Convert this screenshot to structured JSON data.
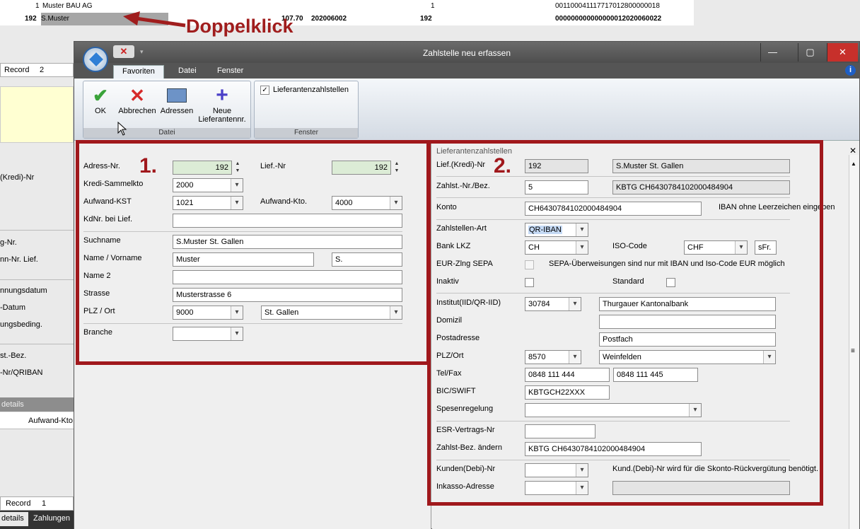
{
  "bg": {
    "row1": {
      "num": "1",
      "name": "Muster BAU AG",
      "col3": "1",
      "code": "001100041117717012800000018"
    },
    "row2": {
      "num": "192",
      "name": "S.Muster",
      "amount": "107.70",
      "date": "202006002",
      "col3": "192",
      "code": "000000000000000012020060022"
    }
  },
  "annotation": {
    "doppelklick": "Doppelklick",
    "section1": "1.",
    "section2": "2."
  },
  "left_panel": {
    "record_label": "Record",
    "record_value": "2",
    "labels": [
      "(Kredi)-Nr",
      "g-Nr.",
      "nn-Nr. Lief.",
      "nnungsdatum",
      "-Datum",
      "ungsbeding.",
      "st.-Bez.",
      "-Nr/QRIBAN"
    ],
    "details_header": "details",
    "aufwand_col": "Aufwand-Kto",
    "record_label2": "Record",
    "record_value2": "1",
    "tabs": [
      "details",
      "Zahlungen"
    ]
  },
  "window": {
    "title": "Zahlstelle neu erfassen",
    "min_icon": "—",
    "max_icon": "▢",
    "close_icon": "✕",
    "menus": [
      "Favoriten",
      "Datei",
      "Fenster"
    ],
    "ribbon": {
      "ok": "OK",
      "abbrechen": "Abbrechen",
      "adressen": "Adressen",
      "neue": "Neue Lieferantennr.",
      "group_datei": "Datei",
      "lieferantenzahlstellen": "Lieferantenzahlstellen",
      "group_fenster": "Fenster"
    }
  },
  "form1": {
    "adress_nr_label": "Adress-Nr.",
    "adress_nr": "192",
    "lief_nr_label": "Lief.-Nr",
    "lief_nr": "192",
    "kredi_label": "Kredi-Sammelkto",
    "kredi": "2000",
    "aufwand_kst_label": "Aufwand-KST",
    "aufwand_kst": "1021",
    "aufwand_kto_label": "Aufwand-Kto.",
    "aufwand_kto": "4000",
    "kdnr_label": "KdNr. bei Lief.",
    "kdnr": "",
    "suchname_label": "Suchname",
    "suchname": "S.Muster St. Gallen",
    "name_label": "Name / Vorname",
    "name": "Muster",
    "vorname": "S.",
    "name2_label": "Name 2",
    "name2": "",
    "strasse_label": "Strasse",
    "strasse": "Musterstrasse 6",
    "plz_label": "PLZ / Ort",
    "plz": "9000",
    "ort": "St. Gallen",
    "branche_label": "Branche",
    "branche": ""
  },
  "form2": {
    "section_title": "Lieferantenzahlstellen",
    "kredi_label": "Lief.(Kredi)-Nr",
    "kredi": "192",
    "kredi_name": "S.Muster St. Gallen",
    "zahlst_label": "Zahlst.-Nr./Bez.",
    "zahlst": "5",
    "zahlst_bez": "KBTG CH6430784102000484904",
    "konto_label": "Konto",
    "konto": "CH6430784102000484904",
    "konto_hint": "IBAN ohne Leerzeichen eingeben",
    "art_label": "Zahlstellen-Art",
    "art": "QR-IBAN",
    "lkz_label": "Bank LKZ",
    "lkz": "CH",
    "iso_label": "ISO-Code",
    "iso": "CHF",
    "iso_sym": "sFr.",
    "sepa_label": "EUR-Zlng SEPA",
    "sepa_hint": "SEPA-Überweisungen sind nur mit IBAN und Iso-Code EUR möglich",
    "inaktiv_label": "Inaktiv",
    "standard_label": "Standard",
    "institut_label": "Institut(IID/QR-IID)",
    "institut": "30784",
    "institut_name": "Thurgauer Kantonalbank",
    "domizil_label": "Domizil",
    "domizil": "",
    "postadresse_label": "Postadresse",
    "postadresse": "Postfach",
    "plzort_label": "PLZ/Ort",
    "plz": "8570",
    "ort": "Weinfelden",
    "telfax_label": "Tel/Fax",
    "tel": "0848 111 444",
    "fax": "0848 111 445",
    "bic_label": "BIC/SWIFT",
    "bic": "KBTGCH22XXX",
    "spesen_label": "Spesenregelung",
    "spesen": "",
    "esr_label": "ESR-Vertrags-Nr",
    "esr": "",
    "bez_aendern_label": "Zahlst-Bez. ändern",
    "bez_aendern": "KBTG CH6430784102000484904",
    "kunden_label": "Kunden(Debi)-Nr",
    "kunden": "",
    "kunden_hint": "Kund.(Debi)-Nr wird für die Skonto-Rückvergütung benötigt.",
    "inkasso_label": "Inkasso-Adresse",
    "inkasso": "",
    "inkasso_extra": ""
  },
  "colors": {
    "annotation_red": "#a0181c",
    "title_bar": "#4e4e4e",
    "close_red": "#c7302b"
  }
}
